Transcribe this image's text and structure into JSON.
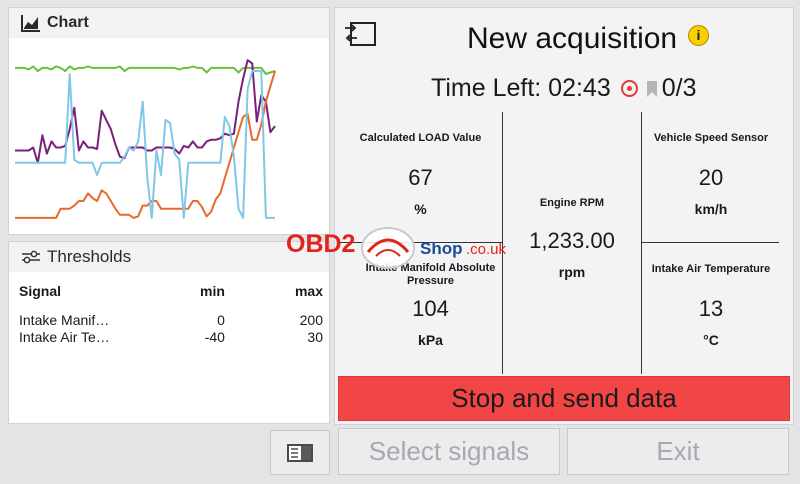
{
  "chart_panel": {
    "title": "Chart"
  },
  "chart_data": {
    "type": "line",
    "title": "",
    "series": [
      {
        "color": "#6cbf3a",
        "values": [
          82,
          82,
          82,
          81,
          83,
          80,
          82,
          82,
          81,
          83,
          82,
          80,
          83,
          81,
          82,
          82,
          83,
          82,
          82,
          82,
          82,
          82,
          82,
          83,
          80,
          82,
          82,
          82,
          82,
          82,
          82,
          82,
          82,
          82,
          82,
          82,
          81,
          82,
          82,
          83,
          82,
          82,
          79,
          82,
          82,
          82,
          82,
          82,
          82,
          79,
          82,
          82,
          82,
          82,
          82,
          78,
          79,
          80
        ]
      },
      {
        "color": "#7a1f7a",
        "values": [
          28,
          28,
          28,
          28,
          30,
          20,
          38,
          26,
          34,
          30,
          30,
          31,
          42,
          56,
          28,
          34,
          30,
          30,
          29,
          54,
          48,
          42,
          32,
          24,
          23,
          30,
          30,
          30,
          30,
          28,
          28,
          30,
          30,
          30,
          30,
          29,
          26,
          31,
          30,
          34,
          30,
          30,
          34,
          35,
          35,
          36,
          39,
          38,
          39,
          60,
          75,
          87,
          85,
          47,
          64,
          60,
          40,
          44
        ]
      },
      {
        "color": "#e86a2a",
        "values": [
          -16,
          -16,
          -16,
          -16,
          -16,
          -16,
          -16,
          -16,
          -16,
          -16,
          -10,
          -10,
          -10,
          -8,
          -5,
          -5,
          0,
          -3,
          -5,
          2,
          0,
          -5,
          -10,
          -14,
          -14,
          -14,
          -16,
          -15,
          -8,
          -8,
          -5,
          -5,
          -10,
          -10,
          -10,
          -10,
          -10,
          -10,
          -10,
          -5,
          -5,
          -9,
          -15,
          -12,
          -4,
          0,
          10,
          20,
          30,
          40,
          50,
          52,
          35,
          35,
          45,
          60,
          70,
          80
        ]
      },
      {
        "color": "#7fc8e8",
        "values": [
          20,
          20,
          20,
          20,
          20,
          20,
          20,
          20,
          20,
          20,
          20,
          20,
          78,
          22,
          20,
          20,
          20,
          20,
          12,
          20,
          20,
          20,
          20,
          20,
          24,
          30,
          28,
          34,
          60,
          10,
          -16,
          28,
          12,
          48,
          46,
          26,
          22,
          -16,
          20,
          20,
          20,
          20,
          20,
          20,
          20,
          20,
          50,
          44,
          24,
          -10,
          -16,
          68,
          80,
          80,
          80,
          -16,
          -16,
          -16
        ]
      }
    ],
    "ylim": [
      -20,
      95
    ],
    "grid": false,
    "legend": "none"
  },
  "thresholds": {
    "title": "Thresholds",
    "headers": {
      "signal": "Signal",
      "min": "min",
      "max": "max"
    },
    "rows": [
      {
        "signal": "Intake Manif…",
        "min": "0",
        "max": "200"
      },
      {
        "signal": "Intake Air Te…",
        "min": "-40",
        "max": "30"
      }
    ]
  },
  "acquisition": {
    "title": "New acquisition",
    "info_icon": "i",
    "time_left_label": "Time Left: 02:43",
    "marker_count": "0/3",
    "signals": [
      {
        "name": "Calculated LOAD Value",
        "value": "67",
        "unit": "%"
      },
      {
        "name": "Engine RPM",
        "value": "1,233.00",
        "unit": "rpm"
      },
      {
        "name": "Vehicle Speed Sensor",
        "value": "20",
        "unit": "km/h"
      },
      {
        "name": "Intake Manifold Absolute Pressure",
        "value": "104",
        "unit": "kPa"
      },
      {
        "name": "Intake Air Temperature",
        "value": "13",
        "unit": "°C"
      }
    ]
  },
  "buttons": {
    "stop": "Stop and send data",
    "select": "Select signals",
    "exit": "Exit"
  },
  "watermark": {
    "brand": "OBD2",
    "shop": "Shop",
    "domain": ".co.uk"
  },
  "colors": {
    "stop_button": "#f24646",
    "info": "#f7d000",
    "record": "#e53935"
  }
}
